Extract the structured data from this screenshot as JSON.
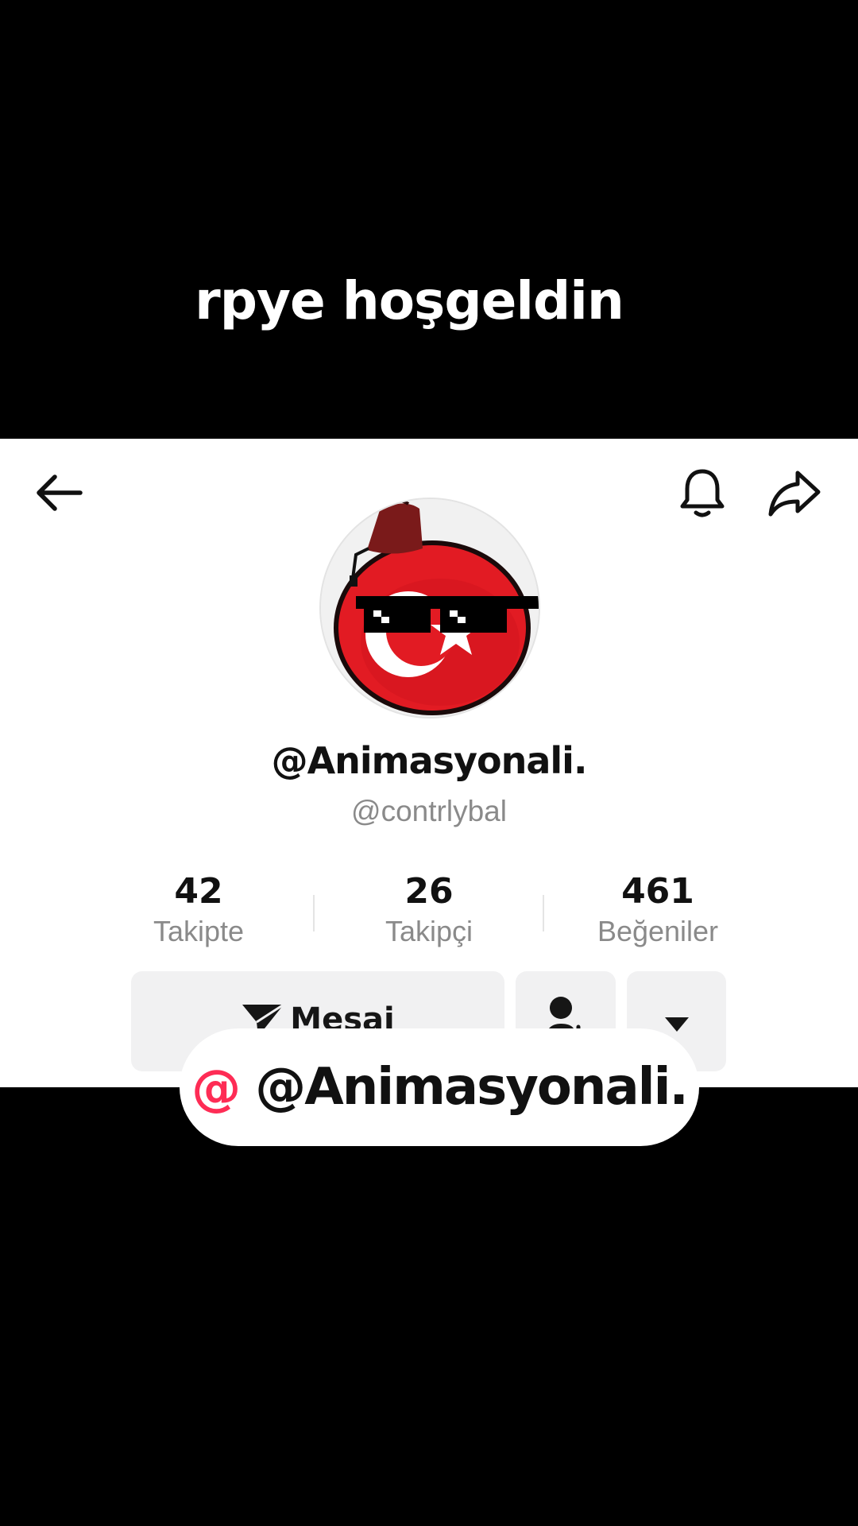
{
  "caption": "rpye hoşgeldin",
  "profile": {
    "display_name": "@Animasyonali.",
    "username": "@contrlybal"
  },
  "stats": [
    {
      "value": "42",
      "label": "Takipte"
    },
    {
      "value": "26",
      "label": "Takipçi"
    },
    {
      "value": "461",
      "label": "Beğeniler"
    }
  ],
  "actions": {
    "message_label": "Mesaj",
    "message_icon": "send-icon",
    "follow_icon": "add-friend-icon",
    "more_icon": "caret-down-icon"
  },
  "topbar": {
    "back_icon": "arrow-left-icon",
    "bell_icon": "bell-icon",
    "share_icon": "share-icon"
  },
  "mention": {
    "symbol": "@",
    "text": "@Animasyonali."
  },
  "colors": {
    "background": "#000000",
    "panel": "#ffffff",
    "accent": "#fe2c55",
    "muted_text": "#8a8a8a",
    "button_bg": "#f1f1f2"
  }
}
